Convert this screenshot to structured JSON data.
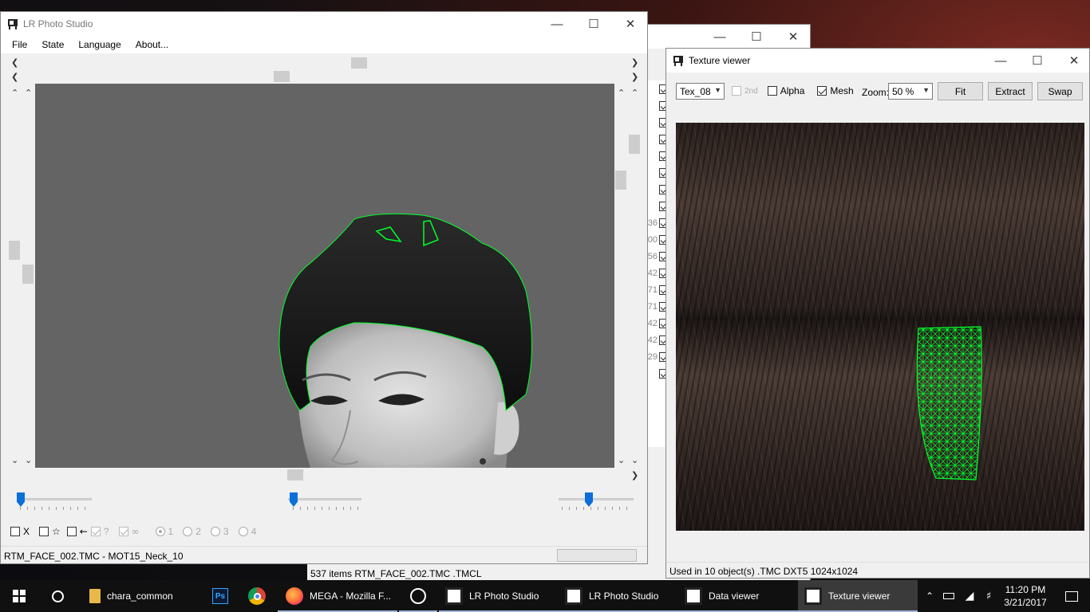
{
  "lr_window": {
    "title": "LR Photo Studio",
    "menu": [
      "File",
      "State",
      "Language",
      "About..."
    ],
    "options": {
      "x_label": "X",
      "star_label": "☆",
      "arrow_label": "←",
      "q_label": "?",
      "inf_label": "∞",
      "radio_labels": [
        "1",
        "2",
        "3",
        "4"
      ]
    },
    "status_text": "RTM_FACE_002.TMC - MOT15_Neck_10"
  },
  "data_viewer": {
    "row_numbers": [
      "36",
      "00",
      "56",
      "42",
      "71",
      "71",
      "42",
      "42",
      "29"
    ],
    "status_text": "537 items  RTM_FACE_002.TMC  .TMCL"
  },
  "texture_viewer": {
    "title": "Texture viewer",
    "texture_select": "Tex_08",
    "second_label": "2nd",
    "alpha_label": "Alpha",
    "alpha_checked": false,
    "mesh_label": "Mesh",
    "mesh_checked": true,
    "zoom_label": "Zoom:",
    "zoom_value": "50 %",
    "fit_label": "Fit",
    "extract_label": "Extract",
    "swap_label": "Swap",
    "status_text": "Used in 10 object(s)  .TMC  DXT5  1024x1024"
  },
  "taskbar": {
    "items": [
      {
        "label": "chara_common",
        "icon": "folder-icon"
      },
      {
        "label": "",
        "icon": "photoshop-icon"
      },
      {
        "label": "",
        "icon": "chrome-icon"
      },
      {
        "label": "MEGA - Mozilla F...",
        "icon": "firefox-icon"
      },
      {
        "label": "",
        "icon": "clock-app-icon"
      },
      {
        "label": "LR Photo Studio",
        "icon": "lr-app-icon"
      },
      {
        "label": "LR Photo Studio",
        "icon": "lr-app-icon"
      },
      {
        "label": "Data viewer",
        "icon": "lr-app-icon"
      },
      {
        "label": "Texture viewer",
        "icon": "lr-app-icon"
      }
    ],
    "time": "11:20 PM",
    "date": "3/21/2017"
  },
  "colors": {
    "accent": "#0a6fd8",
    "mesh_green": "#00ff2a",
    "viewport_bg": "#646464"
  }
}
